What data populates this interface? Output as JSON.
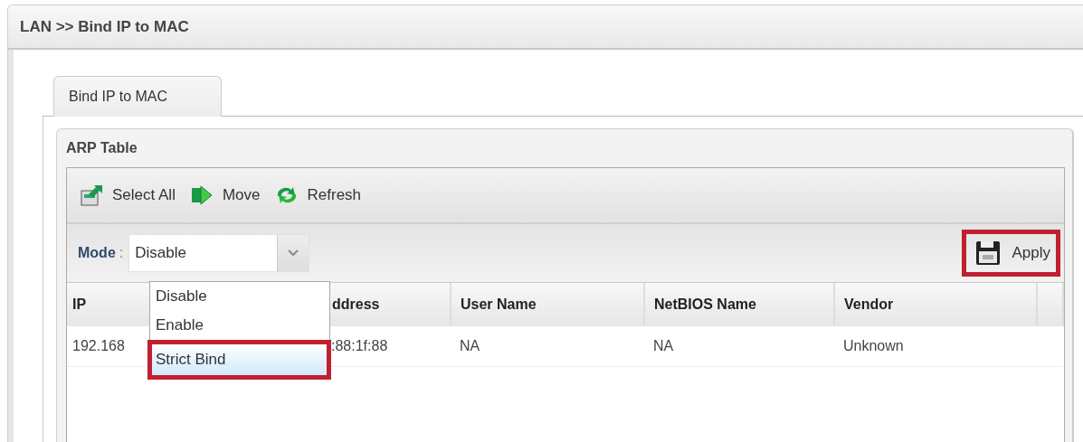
{
  "breadcrumb": "LAN >> Bind IP to MAC",
  "tabs": [
    {
      "label": "Bind IP to MAC",
      "selected": true
    }
  ],
  "panel": {
    "title": "ARP Table"
  },
  "toolbar": [
    {
      "label": "Select All"
    },
    {
      "label": "Move"
    },
    {
      "label": "Refresh"
    }
  ],
  "mode": {
    "label": "Mode",
    "separator": ":",
    "value": "Disable",
    "expanded": true,
    "options": [
      {
        "label": "Disable",
        "hovered": false,
        "highlighted": false
      },
      {
        "label": "Enable",
        "hovered": false,
        "highlighted": false
      },
      {
        "label": "Strict Bind",
        "hovered": true,
        "highlighted": true
      }
    ]
  },
  "apply": {
    "label": "Apply",
    "highlighted": true
  },
  "table": {
    "columns": [
      "IP",
      "ddress",
      "User Name",
      "NetBIOS Name",
      "Vendor"
    ],
    "rows": [
      [
        "192.168",
        ":88:1f:88",
        "NA",
        "NA",
        "Unknown"
      ]
    ]
  }
}
